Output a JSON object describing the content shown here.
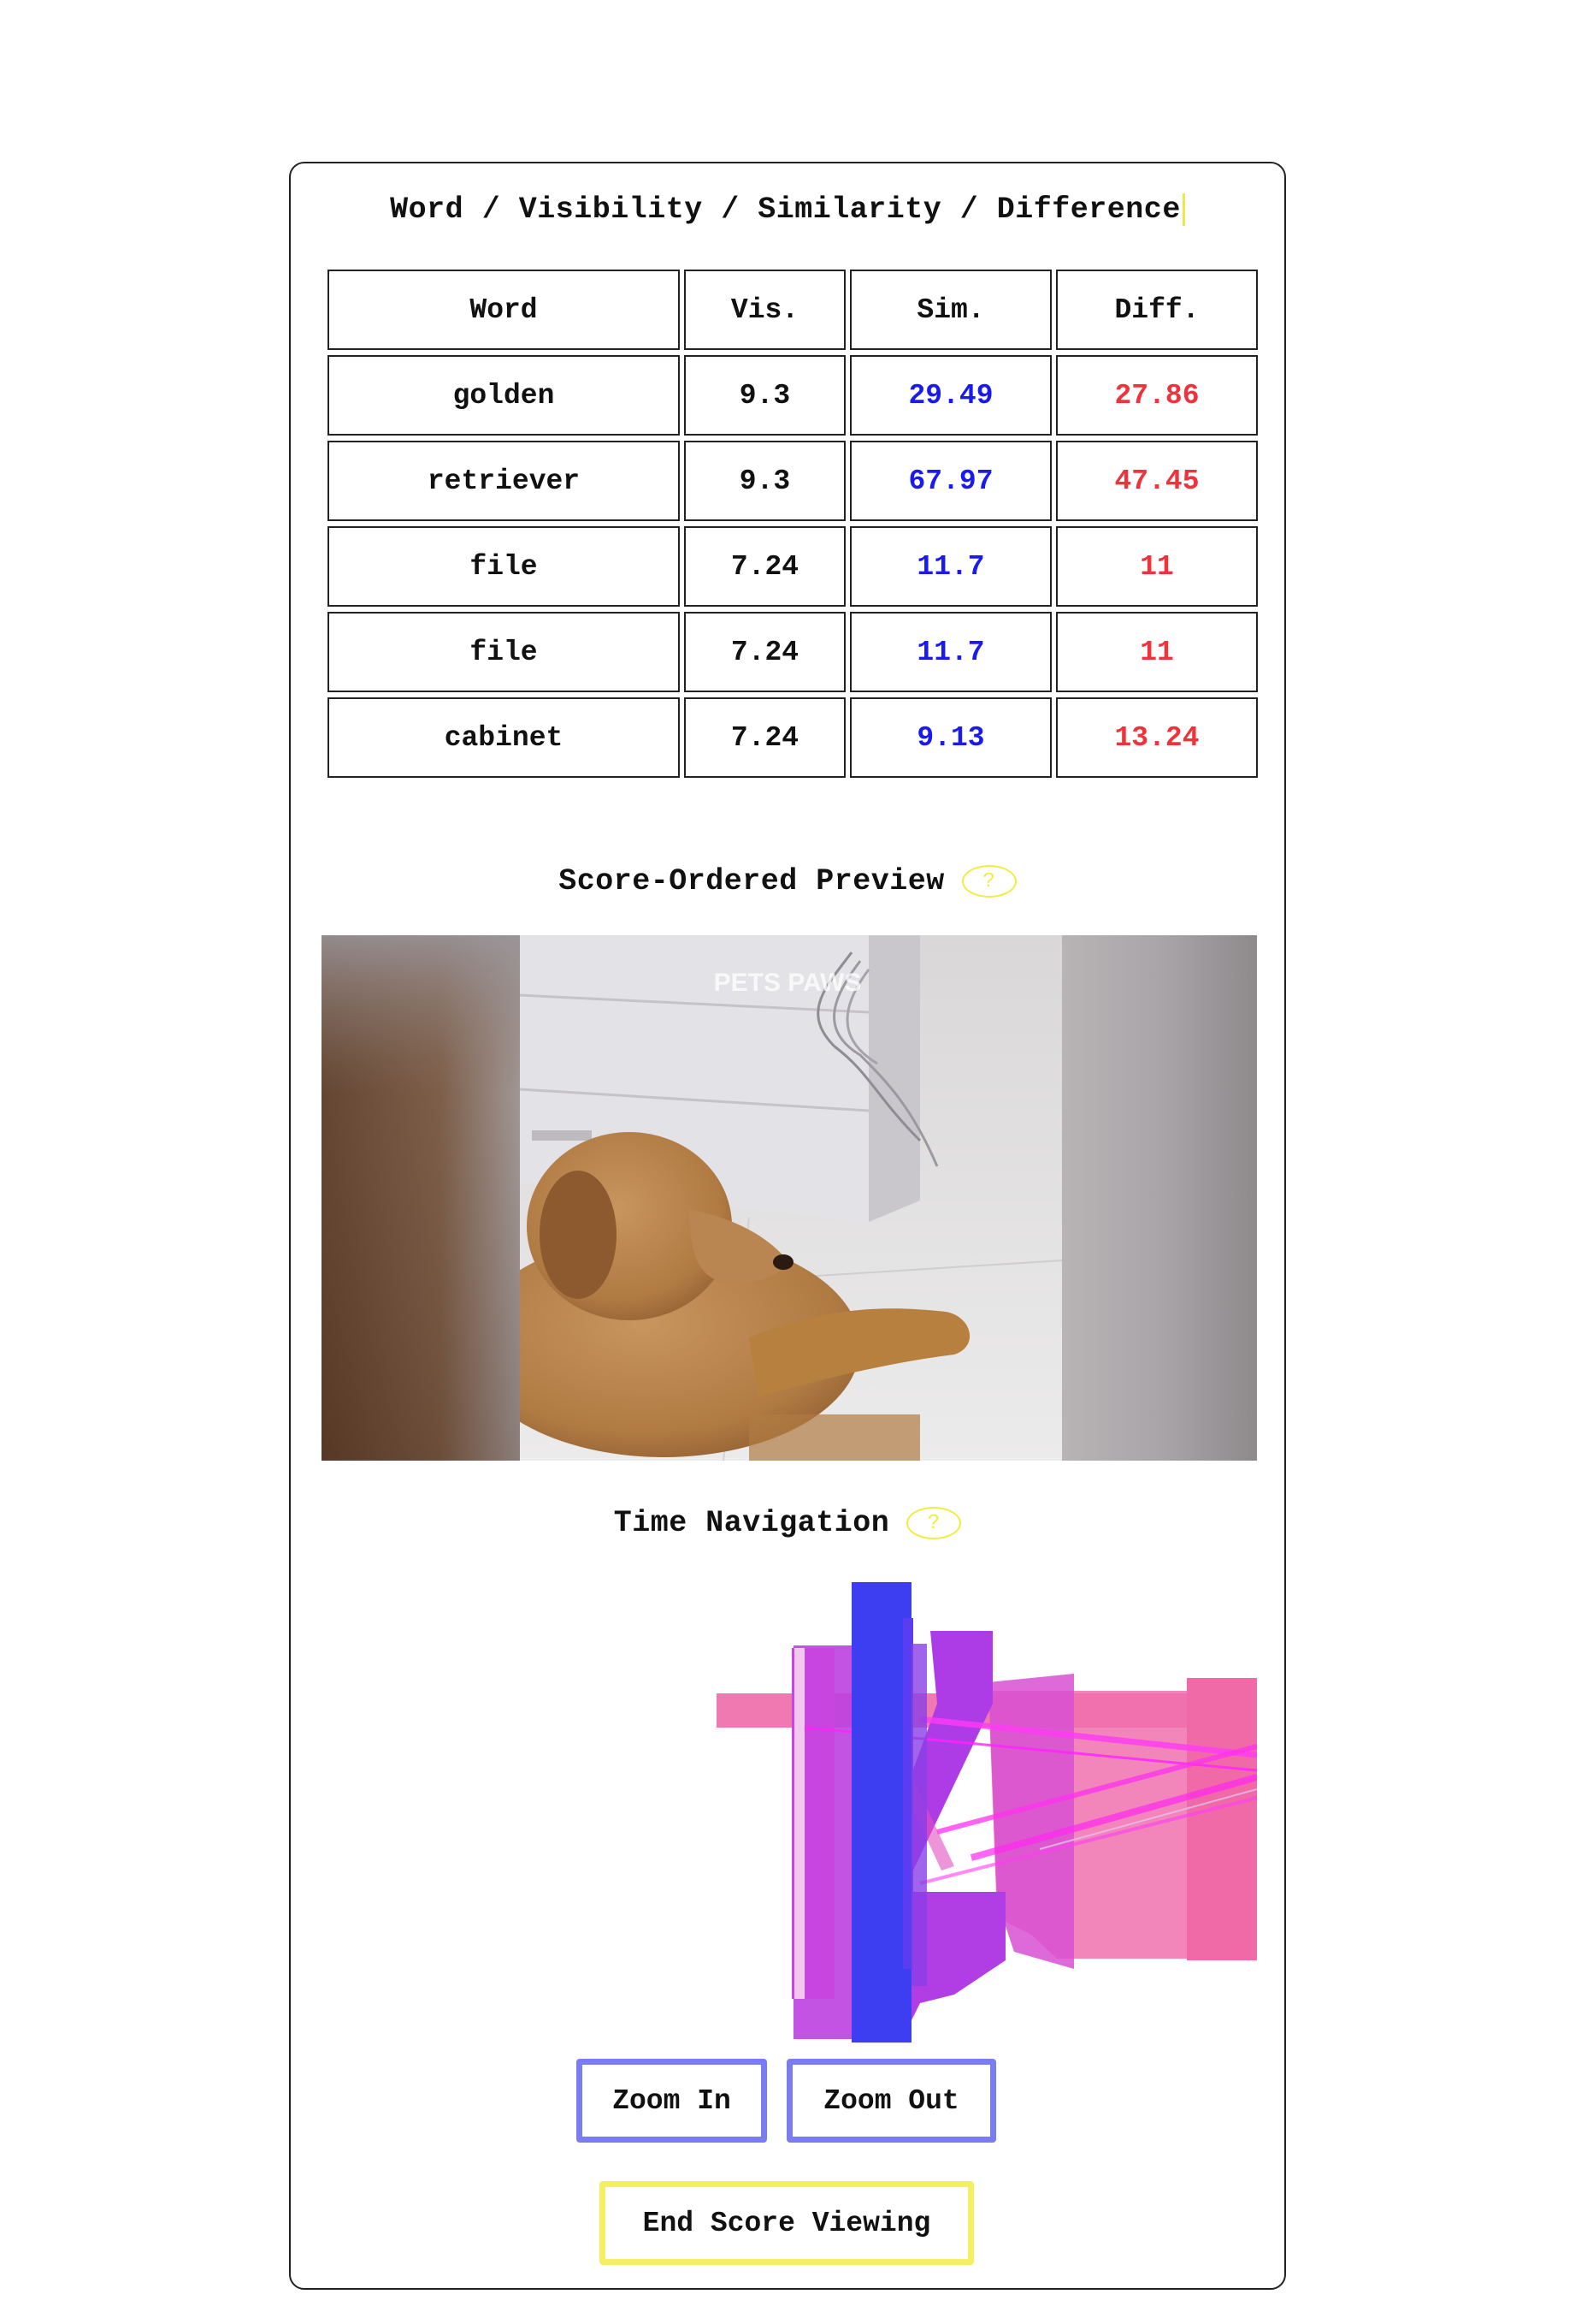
{
  "header": {
    "title": "Word / Visibility / Similarity / Difference"
  },
  "table": {
    "columns": [
      "Word",
      "Vis.",
      "Sim.",
      "Diff."
    ],
    "rows": [
      {
        "word": "golden",
        "vis": "9.3",
        "sim": "29.49",
        "diff": "27.86"
      },
      {
        "word": "retriever",
        "vis": "9.3",
        "sim": "67.97",
        "diff": "47.45"
      },
      {
        "word": "file",
        "vis": "7.24",
        "sim": "11.7",
        "diff": "11"
      },
      {
        "word": "file",
        "vis": "7.24",
        "sim": "11.7",
        "diff": "11"
      },
      {
        "word": "cabinet",
        "vis": "7.24",
        "sim": "9.13",
        "diff": "13.24"
      }
    ]
  },
  "preview": {
    "title": "Score-Ordered Preview",
    "help_label": "?",
    "watermark": "PETS PAWS"
  },
  "timeline": {
    "title": "Time Navigation",
    "help_label": "?"
  },
  "buttons": {
    "zoom_in": "Zoom In",
    "zoom_out": "Zoom Out",
    "end": "End Score Viewing"
  },
  "colors": {
    "similarity": "#1a1aee",
    "difference": "#f0323c",
    "accent_blue": "#7a7cf2",
    "accent_yellow": "#f5f060"
  }
}
